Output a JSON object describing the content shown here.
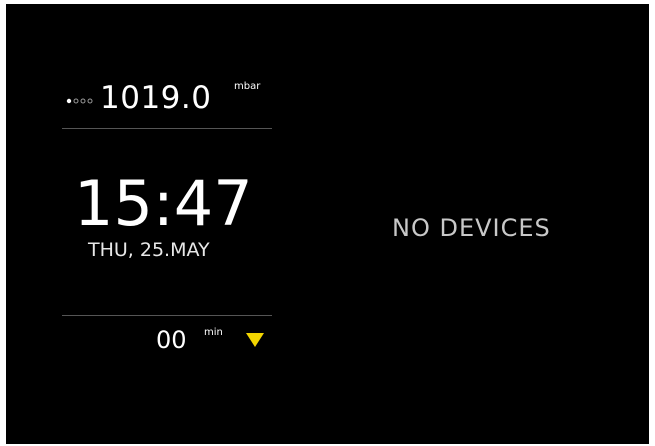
{
  "pressure": {
    "signal_icon": "signal-strength-dots-icon",
    "value": "1019.0",
    "unit": "mbar"
  },
  "clock": {
    "time": "15:47",
    "date": "THU, 25.MAY"
  },
  "timer": {
    "value": "00",
    "unit": "min",
    "arrow_icon": "triangle-down-icon",
    "arrow_color": "#f2d500"
  },
  "status": {
    "text": "NO DEVICES"
  },
  "colors": {
    "background": "#000000",
    "foreground": "#ffffff",
    "accent": "#f2d500"
  }
}
